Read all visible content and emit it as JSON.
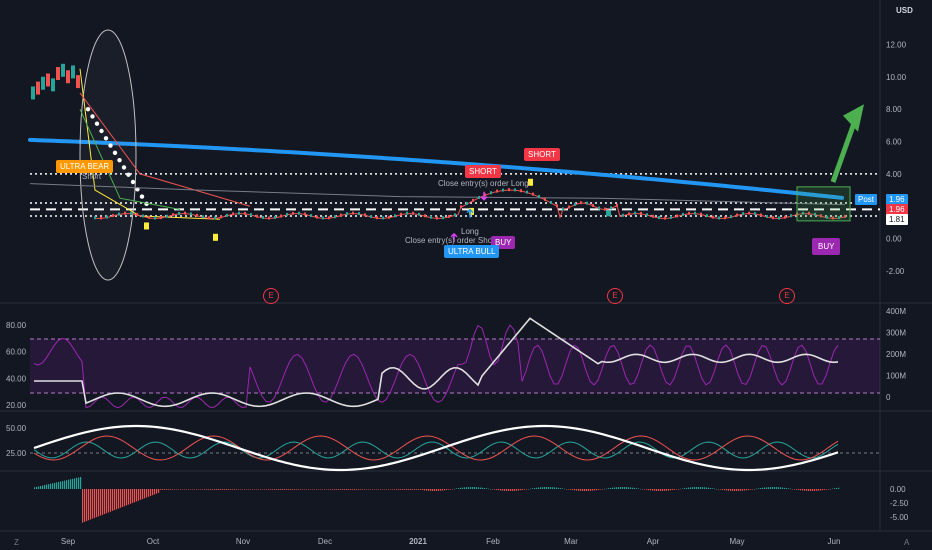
{
  "currency": "USD",
  "price_axis": {
    "labels": [
      "12.00",
      "10.00",
      "8.00",
      "6.00",
      "4.00",
      "2.00",
      "0.00",
      "-2.00"
    ],
    "values": [
      12,
      10,
      8,
      6,
      4,
      2,
      0,
      -2
    ],
    "range": [
      -2.8,
      14.0
    ]
  },
  "price_tags": {
    "post_label": "Post",
    "post_value": "1.96",
    "last_value": "1.96",
    "level_value": "1.81"
  },
  "dotted_levels": [
    4.0,
    2.2,
    1.4
  ],
  "dashed_level": 1.81,
  "trade_labels": [
    {
      "text": "ULTRA BEAR",
      "color": "#ff9800"
    },
    {
      "text": "SHORT",
      "color": "#f23645"
    },
    {
      "text": "SHORT",
      "color": "#f23645"
    },
    {
      "text": "ULTRA BULL",
      "color": "#2196f3"
    },
    {
      "text": "BUY",
      "color": "#9c27b0"
    },
    {
      "text": "BUY",
      "color": "#9c27b0"
    }
  ],
  "annotations": {
    "short_small": "Short",
    "close_long": "Close entry(s) order Long",
    "long": "Long",
    "close_short": "Close entry(s) order Short"
  },
  "earnings_marker": "E",
  "x_axis": {
    "labels": [
      "Sep",
      "Oct",
      "Nov",
      "Dec",
      "2021",
      "Feb",
      "Mar",
      "Apr",
      "May",
      "Jun"
    ],
    "bold_label": "2021"
  },
  "pane2_axis": {
    "left_labels": [
      "80.00",
      "60.00",
      "40.00",
      "20.00"
    ],
    "left_values": [
      80,
      60,
      40,
      20
    ],
    "right_labels": [
      "400M",
      "300M",
      "200M",
      "100M",
      "0"
    ],
    "right_values": [
      400,
      300,
      200,
      100,
      0
    ]
  },
  "pane3_axis": {
    "labels": [
      "50.00",
      "25.00"
    ],
    "values": [
      50,
      25
    ]
  },
  "pane4_axis": {
    "labels": [
      "0.00",
      "-2.50",
      "-5.00"
    ],
    "values": [
      0,
      -2.5,
      -5
    ]
  },
  "footer": {
    "left_icon_label": "Z",
    "right_icon_label": "A"
  },
  "colors": {
    "background": "#131722",
    "blue_ma": "#2196f3",
    "green_arrow": "#4caf50",
    "rsi_white": "#e0e0e0",
    "rsi_purple": "#9c27b0",
    "adx": "#ffffff",
    "di_plus": "#26a69a",
    "di_minus": "#ef5350"
  }
}
